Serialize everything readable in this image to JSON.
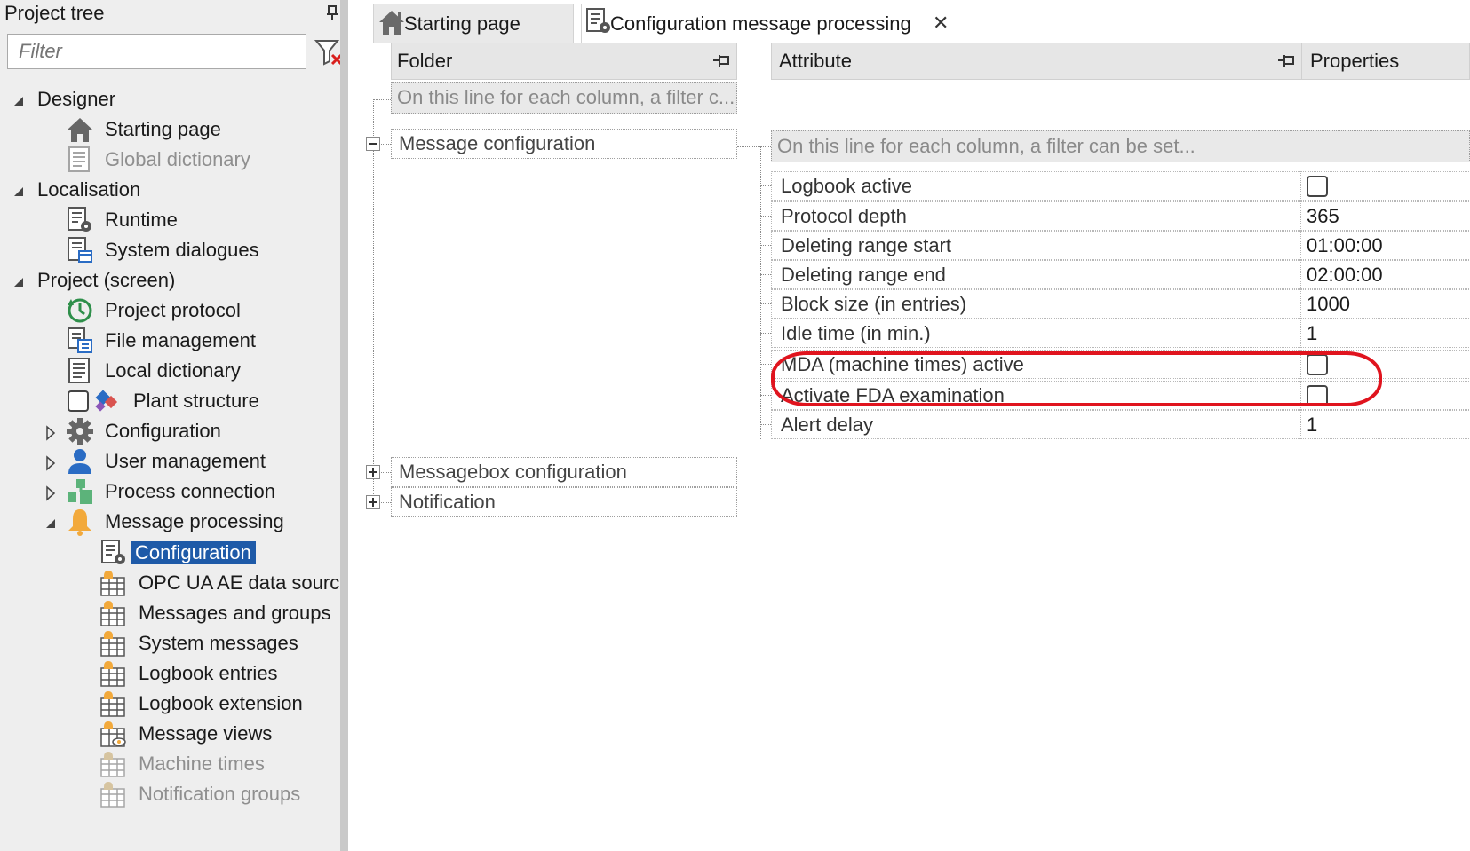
{
  "left_panel": {
    "title": "Project tree",
    "filter_placeholder": "Filter",
    "tree": [
      {
        "label": "Designer",
        "icon": "triangle-expanded-icon"
      },
      {
        "label": "Starting page",
        "icon": "home-icon"
      },
      {
        "label": "Global dictionary",
        "icon": "dictionary-icon"
      },
      {
        "label": "Localisation",
        "icon": "triangle-expanded-icon"
      },
      {
        "label": "Runtime",
        "icon": "config-doc-icon"
      },
      {
        "label": "System dialogues",
        "icon": "dialog-doc-icon"
      },
      {
        "label": "Project (screen)",
        "icon": "triangle-expanded-icon"
      },
      {
        "label": "Project protocol",
        "icon": "history-icon"
      },
      {
        "label": "File management",
        "icon": "file-management-icon"
      },
      {
        "label": "Local dictionary",
        "icon": "dictionary-icon"
      },
      {
        "label": "Plant structure",
        "icon": "plant-structure-icon"
      },
      {
        "label": "Configuration",
        "icon": "gear-icon"
      },
      {
        "label": "User management",
        "icon": "user-icon"
      },
      {
        "label": "Process connection",
        "icon": "process-connection-icon"
      },
      {
        "label": "Message processing",
        "icon": "bell-icon"
      },
      {
        "label": "Configuration",
        "icon": "config-doc-icon"
      },
      {
        "label": "OPC UA AE data sourc",
        "icon": "message-table-icon"
      },
      {
        "label": "Messages and groups",
        "icon": "message-table-icon"
      },
      {
        "label": "System messages",
        "icon": "message-table-icon"
      },
      {
        "label": "Logbook entries",
        "icon": "message-table-icon"
      },
      {
        "label": "Logbook extension",
        "icon": "message-table-icon"
      },
      {
        "label": "Message views",
        "icon": "message-view-icon"
      },
      {
        "label": "Machine times",
        "icon": "message-table-icon"
      },
      {
        "label": "Notification groups",
        "icon": "message-table-icon"
      }
    ]
  },
  "tabs": [
    {
      "label": "Starting page",
      "icon": "home-icon"
    },
    {
      "label": "Configuration message processing",
      "icon": "config-doc-icon",
      "close": "✕"
    }
  ],
  "folder_grid": {
    "header": "Folder",
    "filter_text": "On this line for each column, a filter c...",
    "nodes": [
      "Message configuration",
      "Messagebox configuration",
      "Notification"
    ]
  },
  "properties_grid": {
    "attr_header": "Attribute",
    "props_header": "Properties",
    "filter_text": "On this line for each column, a filter can be set...",
    "rows": [
      {
        "attribute": "Logbook active",
        "value": "",
        "type": "checkbox",
        "checked": false
      },
      {
        "attribute": "Protocol depth",
        "value": "365",
        "type": "text"
      },
      {
        "attribute": "Deleting range start",
        "value": "01:00:00",
        "type": "text"
      },
      {
        "attribute": "Deleting range end",
        "value": "02:00:00",
        "type": "text"
      },
      {
        "attribute": "Block size (in entries)",
        "value": "1000",
        "type": "text"
      },
      {
        "attribute": "Idle time (in min.)",
        "value": "1",
        "type": "text"
      },
      {
        "attribute": "MDA (machine times) active",
        "value": "",
        "type": "checkbox",
        "checked": false
      },
      {
        "attribute": "Activate FDA examination",
        "value": "",
        "type": "checkbox",
        "checked": false
      },
      {
        "attribute": "Alert delay",
        "value": "1",
        "type": "text"
      }
    ]
  },
  "colors": {
    "selection": "#1e5aa8",
    "highlight": "#e0141e",
    "panel_bg": "#eeeeee",
    "header_bg": "#e6e6e6"
  }
}
